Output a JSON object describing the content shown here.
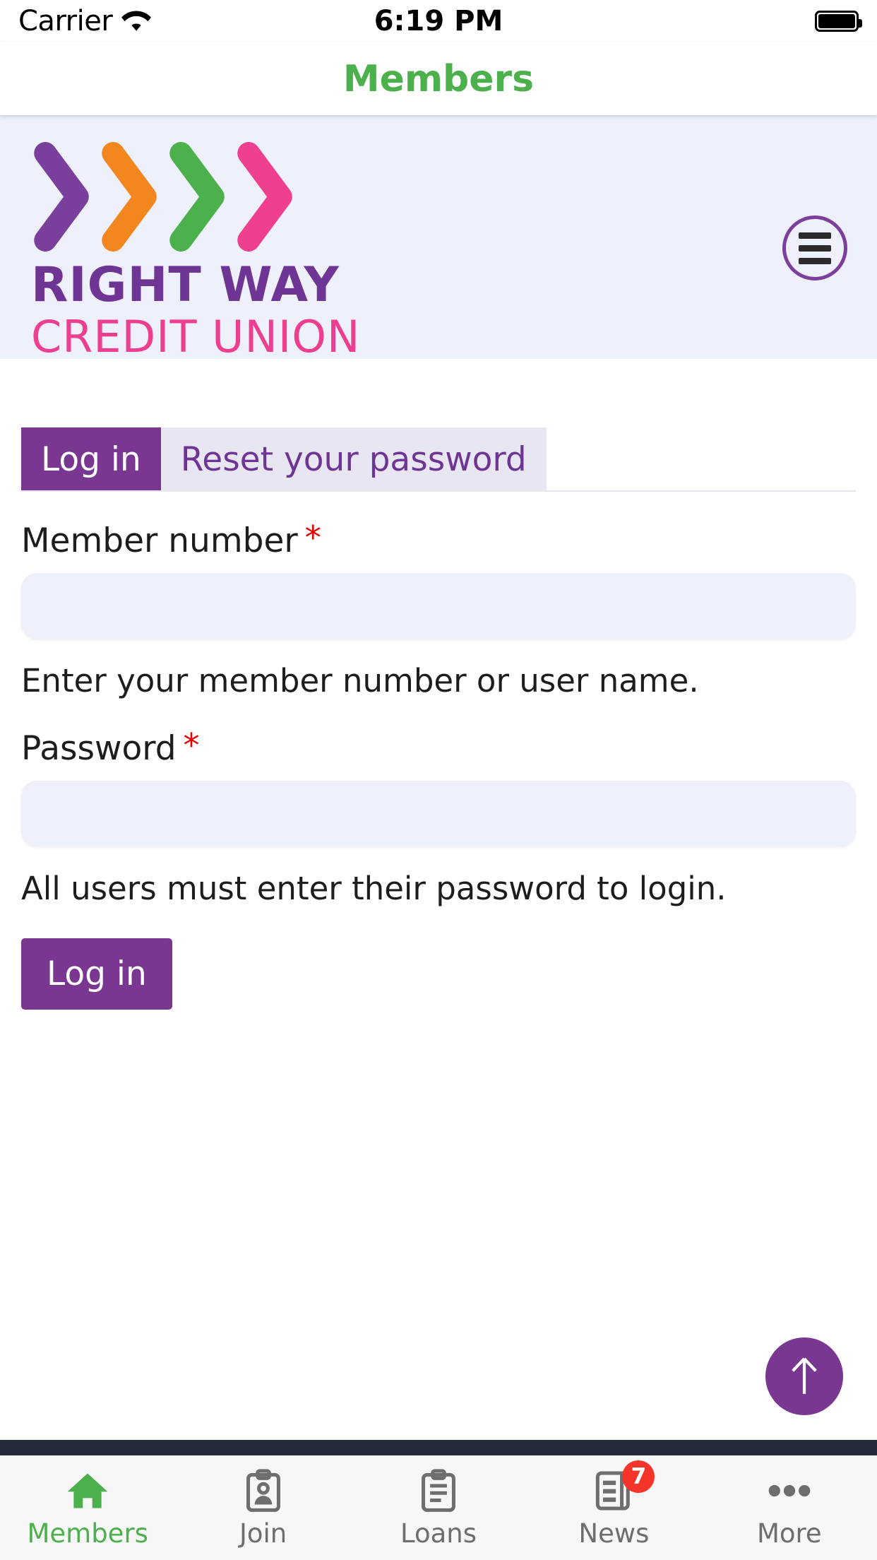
{
  "status_bar": {
    "carrier": "Carrier",
    "wifi_icon": "wifi-icon",
    "time": "6:19 PM",
    "battery_icon": "battery-full-icon"
  },
  "navbar": {
    "title": "Members",
    "title_color": "#4cb04c"
  },
  "brand": {
    "background": "#eef0fb",
    "logo_icon": "right-way-chevrons-logo",
    "chevron_colors": [
      "#7a3f9d",
      "#f2871f",
      "#4cb04c",
      "#ef3f8f"
    ],
    "name_line1": "RIGHT WAY",
    "name_line1_color": "#6f3594",
    "name_line2": "CREDIT UNION",
    "name_line2_color": "#ec3f8f",
    "menu_icon": "hamburger-menu-icon"
  },
  "login_form": {
    "tabs": [
      {
        "label": "Log in",
        "active": true
      },
      {
        "label": "Reset your password",
        "active": false
      }
    ],
    "member_number": {
      "label": "Member number",
      "required_marker": "*",
      "value": "",
      "placeholder": "",
      "help": "Enter your member number or user name."
    },
    "password": {
      "label": "Password",
      "required_marker": "*",
      "value": "",
      "placeholder": "",
      "help": "All users must enter their password to login."
    },
    "submit_label": "Log in",
    "accent_color": "#7a3792"
  },
  "scroll_top": {
    "icon": "arrow-up-icon",
    "color": "#7a3792"
  },
  "tabbar": {
    "items": [
      {
        "label": "Members",
        "icon": "home-icon",
        "active": true,
        "badge": ""
      },
      {
        "label": "Join",
        "icon": "id-card-clipboard-icon",
        "active": false,
        "badge": ""
      },
      {
        "label": "Loans",
        "icon": "clipboard-list-icon",
        "active": false,
        "badge": ""
      },
      {
        "label": "News",
        "icon": "news-document-icon",
        "active": false,
        "badge": "7"
      },
      {
        "label": "More",
        "icon": "ellipsis-icon",
        "active": false,
        "badge": ""
      }
    ],
    "active_color": "#4cb04c",
    "inactive_color": "#6e6e6e",
    "badge_color": "#f5342a"
  }
}
